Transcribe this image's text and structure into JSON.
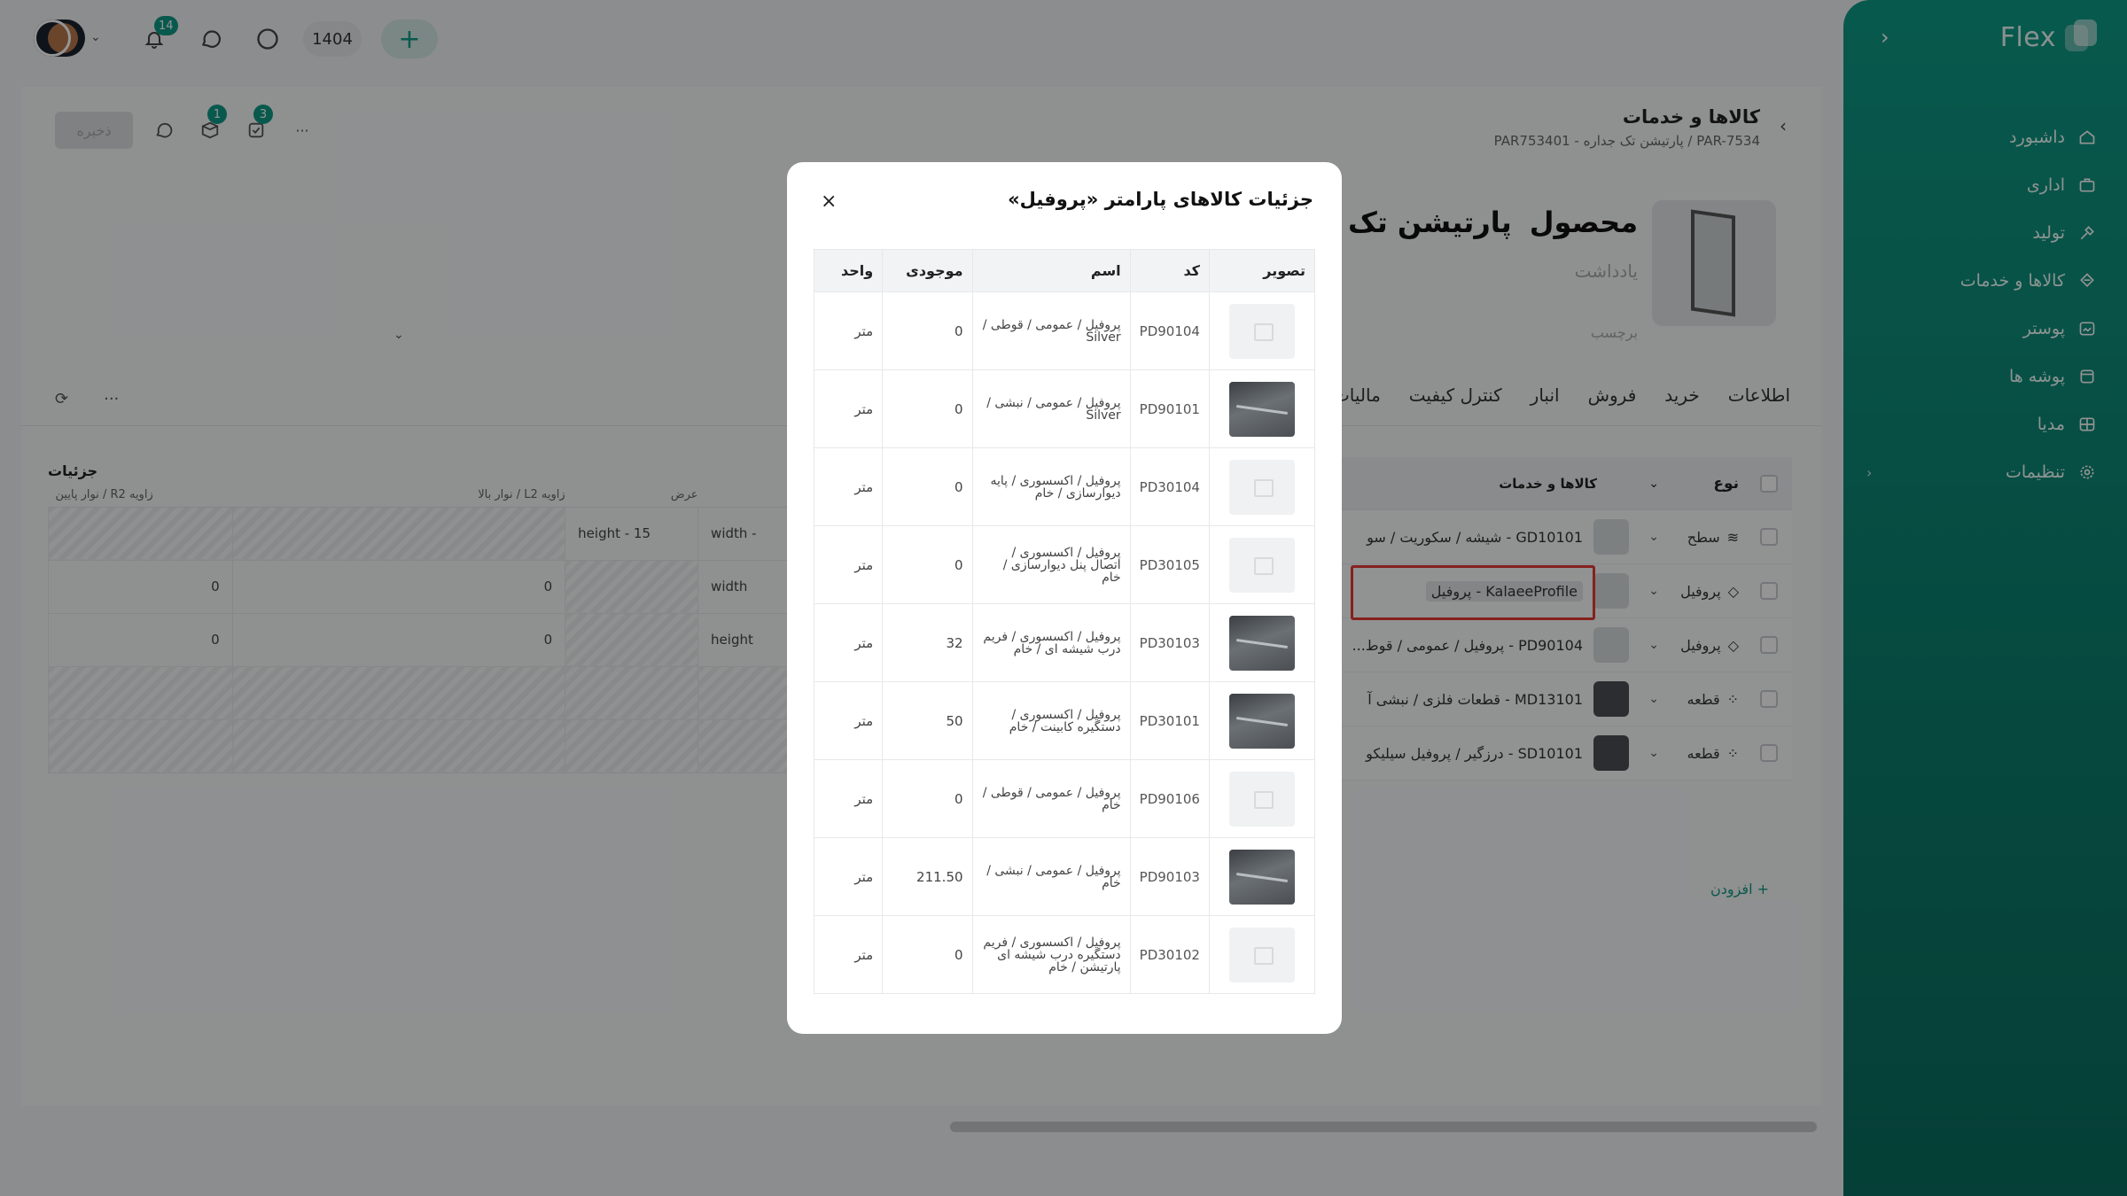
{
  "topbar": {
    "notifications_count": "14",
    "year": "1404",
    "add_label": "+"
  },
  "sidebar": {
    "brand": "Flex",
    "items": [
      {
        "label": "داشبورد",
        "icon": "home-icon"
      },
      {
        "label": "اداری",
        "icon": "briefcase-icon"
      },
      {
        "label": "تولید",
        "icon": "tools-icon"
      },
      {
        "label": "کالاها و خدمات",
        "icon": "cube-icon"
      },
      {
        "label": "پوستر",
        "icon": "poster-icon"
      },
      {
        "label": "پوشه ها",
        "icon": "folder-icon"
      },
      {
        "label": "مدیا",
        "icon": "media-icon"
      },
      {
        "label": "تنظیمات",
        "icon": "gear-icon"
      }
    ]
  },
  "page": {
    "save_label": "ذخیره",
    "badge_one": "1",
    "badge_two": "3",
    "breadcrumb_title": "کالاها و خدمات",
    "breadcrumb_sub": "PAR-7534 / پارتیشن تک جداره - PAR753401",
    "product_kind": "محصول",
    "product_name": "پارتیشن تک ج",
    "note_label": "یادداشت",
    "tag_label": "برچسب",
    "tabs": [
      "اطلاعات",
      "خرید",
      "فروش",
      "انبار",
      "کنترل کیفیت",
      "مالیات"
    ],
    "details_title": "جزئیات",
    "left_headers": [
      "نوار پایین / R2 زاویه",
      "نوار بالا / L2 زاویه",
      "عرض"
    ],
    "left_rows": [
      [
        "",
        "",
        "height - 15",
        "width -"
      ],
      [
        "0",
        "0",
        "",
        "width"
      ],
      [
        "0",
        "0",
        "",
        "height"
      ]
    ],
    "goods_header": {
      "type": "نوع",
      "goods": "کالاها و خدمات"
    },
    "goods_rows": [
      {
        "type": "سطح",
        "name": "GD10101 - شیشه / سکوریت / سو"
      },
      {
        "type": "پروفیل",
        "name": "KalaeeProfile - پروفیل"
      },
      {
        "type": "پروفیل",
        "name": "PD90104 - پروفیل / عمومی / قوط..."
      },
      {
        "type": "قطعه",
        "name": "MD13101 - قطعات فلزی / نبشی آ"
      },
      {
        "type": "قطعه",
        "name": "SD10101 - درزگیر / پروفیل سیلیکو"
      }
    ],
    "add_link": "+ افزودن"
  },
  "modal": {
    "title": "جزئیات کالاهای پارامتر «پروفیل»",
    "close": "×",
    "headers": {
      "image": "تصویر",
      "code": "کد",
      "name": "اسم",
      "stock": "موجودی",
      "unit": "واحد"
    },
    "rows": [
      {
        "img": "placeholder",
        "code": "PD90104",
        "name": "پروفیل / عمومی / قوطی / Silver",
        "stock": "0",
        "unit": "متر"
      },
      {
        "img": "photo",
        "code": "PD90101",
        "name": "پروفیل / عمومی / نبشی / Silver",
        "stock": "0",
        "unit": "متر"
      },
      {
        "img": "placeholder",
        "code": "PD30104",
        "name": "پروفیل / اکسسوری / پایه دیوارسازی / خام",
        "stock": "0",
        "unit": "متر"
      },
      {
        "img": "placeholder",
        "code": "PD30105",
        "name": "پروفیل / اکسسوری / اتصال پنل دیوارسازی / خام",
        "stock": "0",
        "unit": "متر"
      },
      {
        "img": "photo",
        "code": "PD30103",
        "name": "پروفیل / اکسسوری / فریم درب شیشه ای / خام",
        "stock": "32",
        "unit": "متر"
      },
      {
        "img": "photo",
        "code": "PD30101",
        "name": "پروفیل / اکسسوری / دستگیره کابینت / خام",
        "stock": "50",
        "unit": "متر"
      },
      {
        "img": "placeholder",
        "code": "PD90106",
        "name": "پروفیل / عمومی / قوطی / خام",
        "stock": "0",
        "unit": "متر"
      },
      {
        "img": "photo",
        "code": "PD90103",
        "name": "پروفیل / عمومی / نبشی / خام",
        "stock": "211.50",
        "unit": "متر"
      },
      {
        "img": "placeholder",
        "code": "PD30102",
        "name": "پروفیل / اکسسوری / فریم دستگیره درب شیشه ای پارتیشن / خام",
        "stock": "0",
        "unit": "متر"
      }
    ]
  }
}
